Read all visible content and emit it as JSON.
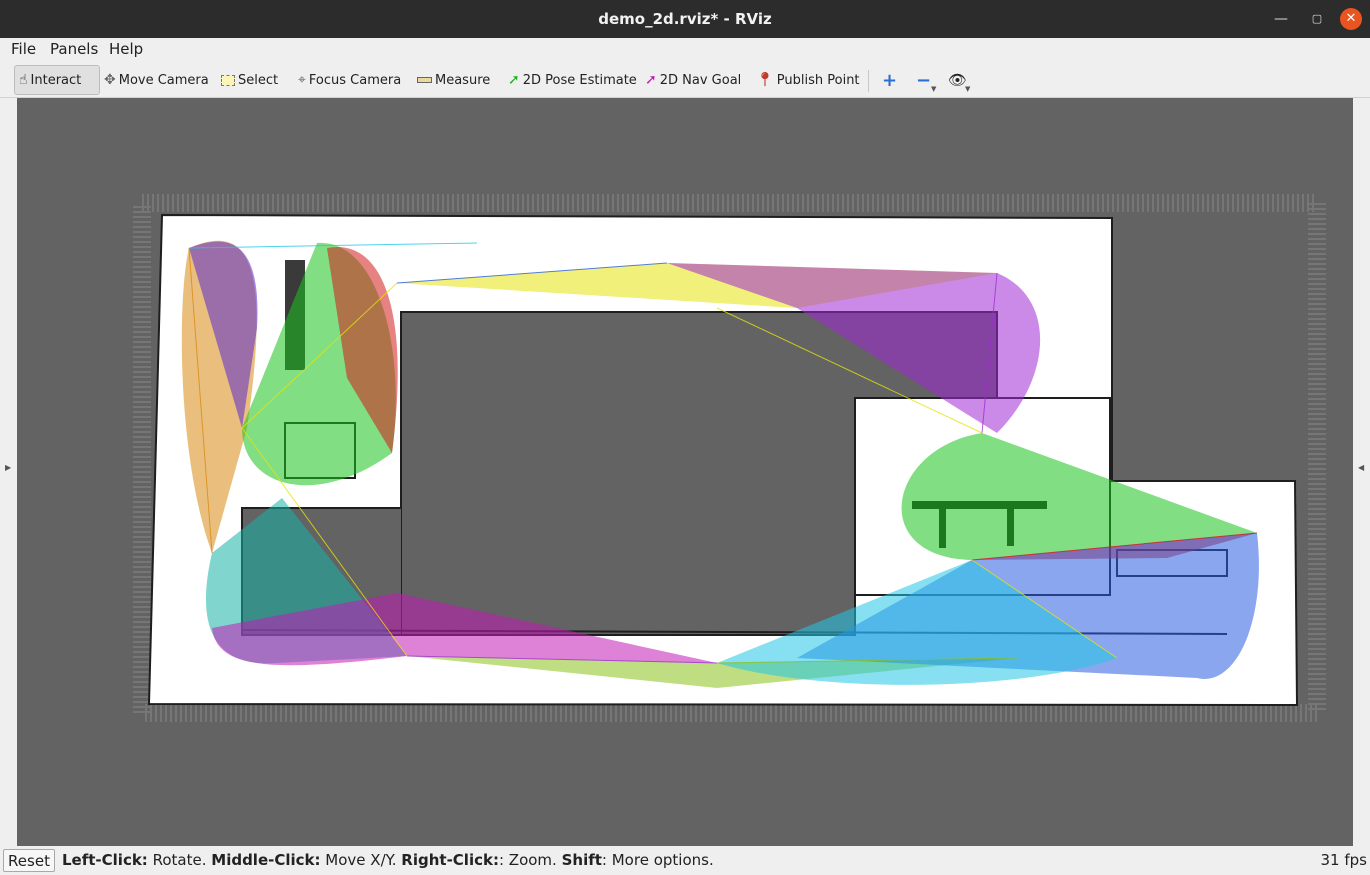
{
  "window": {
    "title": "demo_2d.rviz* - RViz"
  },
  "menubar": {
    "file": "File",
    "panels": "Panels",
    "help": "Help"
  },
  "toolbar": {
    "interact": "Interact",
    "move_camera": "Move Camera",
    "select": "Select",
    "focus_camera": "Focus Camera",
    "measure": "Measure",
    "pose_estimate": "2D Pose Estimate",
    "nav_goal": "2D Nav Goal",
    "publish_point": "Publish Point",
    "icons": [
      "hand-pointer-icon",
      "move-camera-icon",
      "select-rect-icon",
      "focus-camera-icon",
      "measure-ruler-icon",
      "green-arrow-icon",
      "magenta-arrow-icon",
      "red-pin-icon",
      "add-icon",
      "remove-icon",
      "eye-icon"
    ]
  },
  "status": {
    "reset": "Reset",
    "left_click_label": "Left-Click:",
    "left_click_text": "Rotate.",
    "middle_click_label": "Middle-Click:",
    "middle_click_text": "Move X/Y.",
    "right_click_label": "Right-Click:",
    "right_click_text": ": Zoom.",
    "shift_label": "Shift",
    "shift_text": ": More options.",
    "fps": "31 fps"
  },
  "colors": {
    "viewport_bg": "#636363",
    "map_free": "#ffffff",
    "map_wall": "#1e1e1e",
    "scan_colors": [
      "#5a2ccf",
      "#d98a12",
      "#17b3a6",
      "#1bc21b",
      "#e4e40c",
      "#a12ad4",
      "#2a5de0",
      "#d41b1b",
      "#22c7e6",
      "#8bc21b"
    ],
    "titlebar_bg": "#2c2c2c",
    "close_button": "#e95420"
  }
}
